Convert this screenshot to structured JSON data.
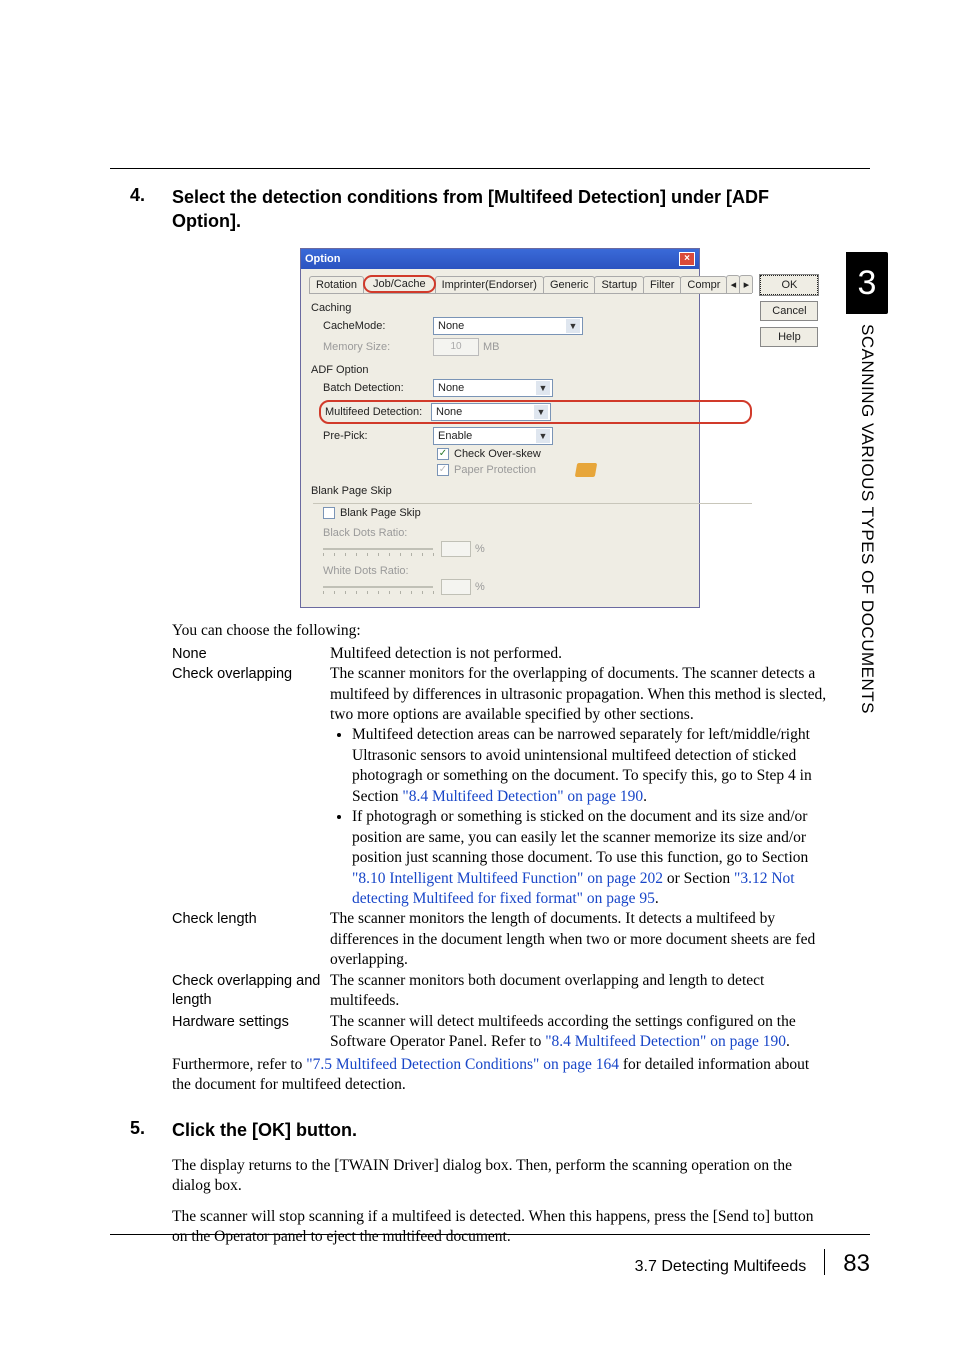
{
  "step4": {
    "num": "4.",
    "title": "Select the detection conditions from [Multifeed Detection] under [ADF Option]."
  },
  "dialog": {
    "title": "Option",
    "close": "×",
    "tabs": {
      "rotation": "Rotation",
      "jobcache": "Job/Cache",
      "imprinter": "Imprinter(Endorser)",
      "generic": "Generic",
      "startup": "Startup",
      "filter": "Filter",
      "compr": "Compr",
      "left": "◂",
      "right": "▸"
    },
    "buttons": {
      "ok": "OK",
      "cancel": "Cancel",
      "help": "Help"
    },
    "caching": {
      "label": "Caching",
      "cachemode": "CacheMode:",
      "cachemode_val": "None",
      "memsize": "Memory Size:",
      "memsize_val": "10",
      "memunit": "MB"
    },
    "adf": {
      "label": "ADF Option",
      "batch": "Batch Detection:",
      "batch_val": "None",
      "multi": "Multifeed Detection:",
      "multi_val": "None",
      "prepick": "Pre-Pick:",
      "prepick_val": "Enable",
      "overskew": "Check Over-skew",
      "paperprotect": "Paper Protection"
    },
    "blank": {
      "label": "Blank Page Skip",
      "chk": "Blank Page Skip",
      "black": "Black Dots Ratio:",
      "white": "White Dots Ratio:",
      "pct": "%"
    }
  },
  "lead": "You can choose the following:",
  "defs": {
    "none": {
      "term": "None",
      "text": "Multifeed detection is not performed."
    },
    "overlap": {
      "term": "Check overlapping",
      "p1": "The scanner monitors for the overlapping of documents. The scanner detects a multifeed by differences in ultrasonic propagation. When this method is slected, two more options are available specified by other sections.",
      "b1a": "Multifeed detection areas can be narrowed separately for left/middle/right Ultrasonic sensors to avoid unintensional multifeed detection of sticked photogragh or something on the document. To specify this, go to Step 4 in Section ",
      "b1link": "\"8.4 Multifeed Detection\" on page 190",
      "b1b": ".",
      "b2a": "If photogragh or something is sticked on the document and its size and/or position are same, you can easily let the scanner memorize its size and/or position just scanning those document. To use this function, go to Section ",
      "b2link1": "\"8.10 Intelligent Multifeed Function\" on page 202",
      "b2mid": " or Section ",
      "b2link2": "\"3.12 Not detecting Multifeed for fixed format\" on page 95",
      "b2end": "."
    },
    "length": {
      "term": "Check length",
      "text": "The scanner monitors the length of documents. It detects a multifeed by differences in the document length when two or more document sheets are fed overlapping."
    },
    "both": {
      "term": "Check overlapping and length",
      "text": "The scanner monitors both document overlapping and length to detect multifeeds."
    },
    "hw": {
      "term": "Hardware settings",
      "a": "The scanner will detect multifeeds according the settings configured on the Software Operator Panel. Refer to ",
      "link": "\"8.4 Multifeed Detection\" on page 190",
      "b": "."
    }
  },
  "tailA": "Furthermore, refer to ",
  "tailLink": "\"7.5 Multifeed Detection Conditions\" on page 164",
  "tailB": " for detailed information about the document for multifeed detection.",
  "step5": {
    "num": "5.",
    "title": "Click the [OK] button.",
    "p1": "The display returns to the [TWAIN Driver] dialog box. Then, perform the scanning operation on the dialog box.",
    "p2": "The scanner will stop scanning if a multifeed is detected. When this happens, press the [Send to] button on the Operator panel to eject the multifeed document."
  },
  "side": {
    "num": "3",
    "text": "SCANNING VARIOUS TYPES OF DOCUMENTS"
  },
  "footer": {
    "section": "3.7 Detecting Multifeeds",
    "page": "83"
  }
}
